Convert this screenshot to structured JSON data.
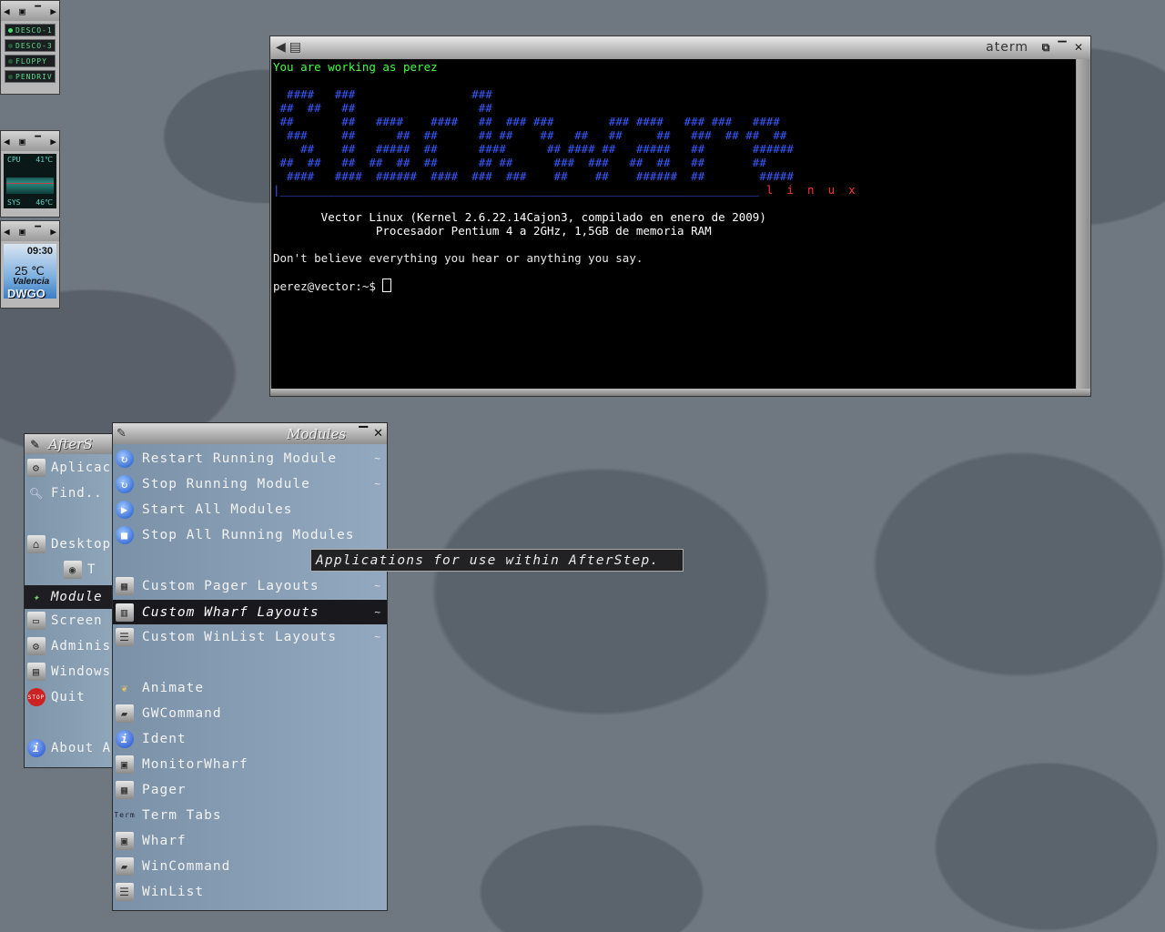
{
  "wharf": {
    "drives": [
      "DESCO-1",
      "DESCO-3",
      "FLOPPY",
      "PENDRIV"
    ],
    "monitor": {
      "cpu_label": "CPU",
      "cpu_temp": "41℃",
      "sys_label": "SYS",
      "sys_temp": "46℃"
    },
    "weather": {
      "time": "09:30",
      "temperature": "25 ℃",
      "city": "Valencia",
      "code": "DWGO"
    }
  },
  "aterm": {
    "title": "aterm",
    "lines": {
      "working": "You are working as perez",
      "art1": "  ####   ###                 ###",
      "art2": " ##  ##   ##                  ##",
      "art3": " ##       ##   ####    ####   ##  ### ###        ### ####   ### ###   ####",
      "art4": "  ###     ##      ##  ##      ## ##    ##   ##   ##     ##   ###  ## ##  ##",
      "art5": "    ##    ##   #####  ##      ####      ## #### ##   #####   ##       ######",
      "art6": " ##  ##   ##  ##  ##  ##      ## ##      ###  ###   ##  ##   ##       ##",
      "art7": "  ####   ####  ######  ####  ###  ###    ##    ##    ######  ##        #####",
      "linux_rule": "|______________________________________________________________________",
      "linux_word": " l  i  n  u  x",
      "kernel": "       Vector Linux (Kernel 2.6.22.14Cajon3, compilado en enero de 2009)",
      "cpu": "               Procesador Pentium 4 a 2GHz, 1,5GB de memoria RAM",
      "quote": "Don't believe everything you hear or anything you say.",
      "prompt": "perez@vector:~$ "
    }
  },
  "root_menu": {
    "title": "AfterS",
    "items": [
      {
        "label": "Aplicac",
        "icon": "gears-icon"
      },
      {
        "label": "Find..",
        "icon": "magnifier-icon"
      },
      {
        "label": "Desktop",
        "icon": "house-icon"
      },
      {
        "label": "T",
        "icon": "eye-icon"
      },
      {
        "label": "Module",
        "icon": "puzzle-icon"
      },
      {
        "label": "Screen",
        "icon": "screen-icon"
      },
      {
        "label": "Adminis",
        "icon": "gears-icon"
      },
      {
        "label": "Windows",
        "icon": "window-icon"
      },
      {
        "label": "Quit",
        "icon": "stop-icon"
      },
      {
        "label": "About A",
        "icon": "info-icon"
      }
    ]
  },
  "modules_menu": {
    "title": "Modules",
    "items": [
      {
        "label": "Restart Running Module",
        "submenu": true
      },
      {
        "label": "Stop Running Module",
        "submenu": true
      },
      {
        "label": "Start All Modules",
        "submenu": false
      },
      {
        "label": "Stop All Running Modules",
        "submenu": false
      },
      {
        "label": "Custom Pager Layouts",
        "submenu": true
      },
      {
        "label": "Custom Wharf Layouts",
        "submenu": true
      },
      {
        "label": "Custom WinList Layouts",
        "submenu": true
      },
      {
        "label": "Animate",
        "submenu": false
      },
      {
        "label": "GWCommand",
        "submenu": false
      },
      {
        "label": "Ident",
        "submenu": false
      },
      {
        "label": "MonitorWharf",
        "submenu": false
      },
      {
        "label": "Pager",
        "submenu": false
      },
      {
        "label": "Term Tabs",
        "submenu": false
      },
      {
        "label": "Wharf",
        "submenu": false
      },
      {
        "label": "WinCommand",
        "submenu": false
      },
      {
        "label": "WinList",
        "submenu": false
      }
    ],
    "selected": "Custom Wharf Layouts",
    "submenu_glyph": "~"
  },
  "tooltip": {
    "text": "Applications for use within AfterStep."
  }
}
